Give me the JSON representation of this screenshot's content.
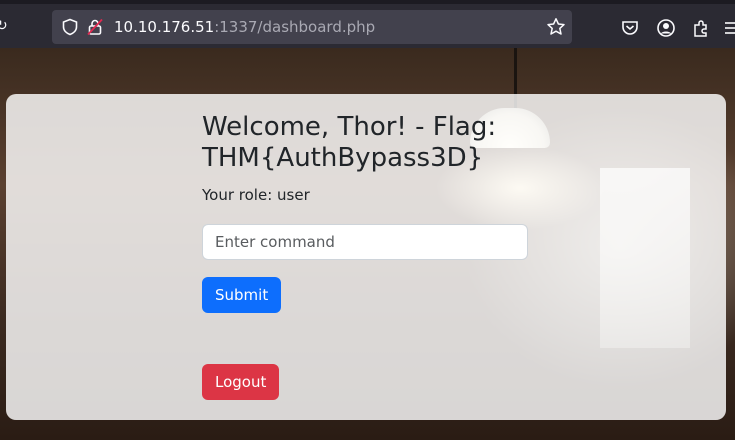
{
  "browser": {
    "url_host": "10.10.176.51",
    "url_rest": ":1337/dashboard.php",
    "icons": [
      "shield-icon",
      "insecure-lock-icon",
      "bookmark-star-icon",
      "pocket-icon",
      "account-icon",
      "extensions-icon",
      "menu-icon"
    ]
  },
  "dashboard": {
    "title": "Welcome, Thor! - Flag: THM{AuthBypass3D}",
    "role_text": "Your role: user",
    "command_placeholder": "Enter command",
    "submit_label": "Submit",
    "logout_label": "Logout"
  },
  "colors": {
    "submit": "#0d6efd",
    "logout": "#dc3545"
  }
}
